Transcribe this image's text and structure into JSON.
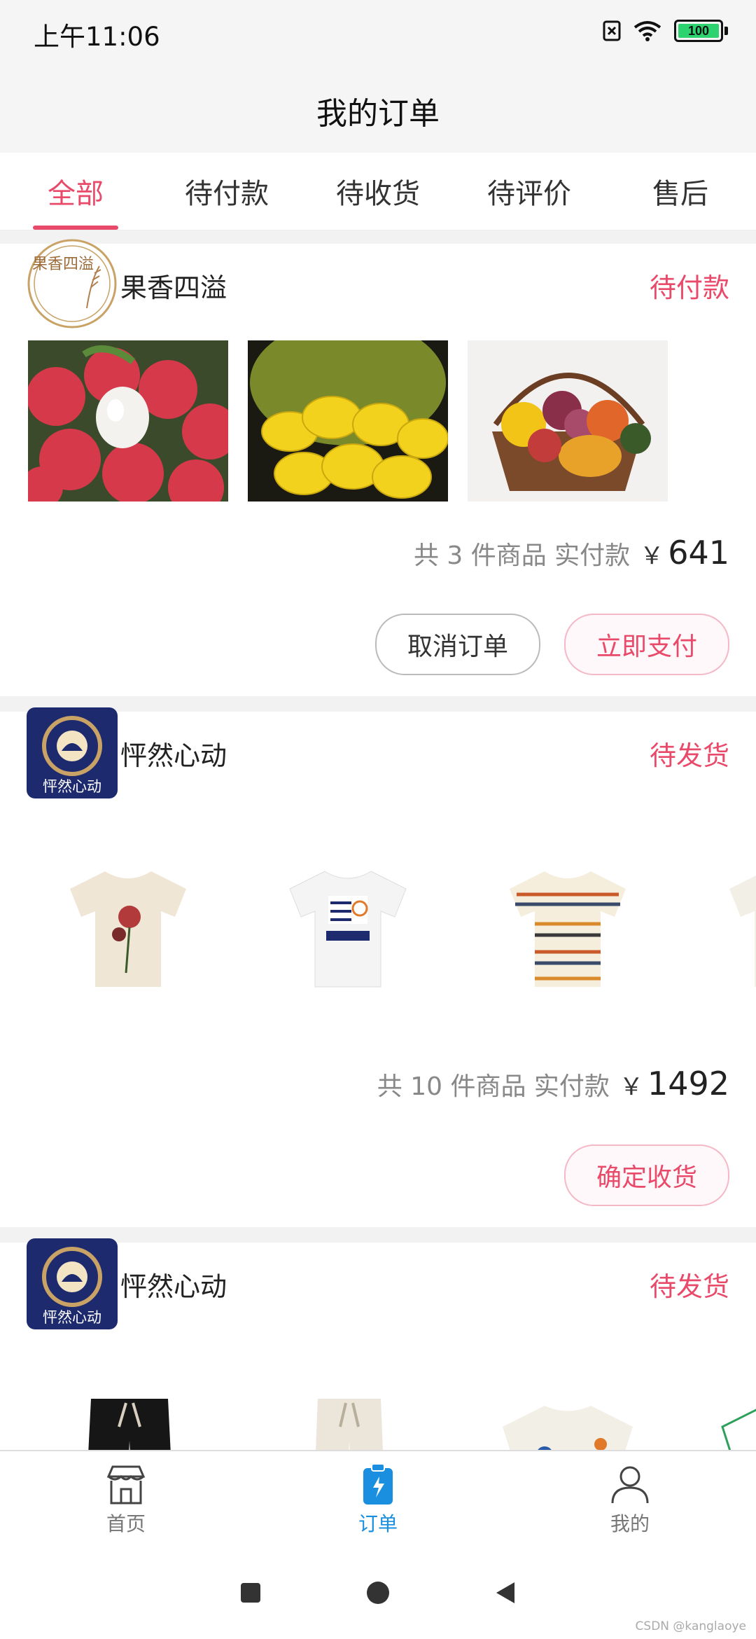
{
  "status_bar": {
    "time": "上午11:06",
    "battery": "100"
  },
  "header": {
    "title": "我的订单"
  },
  "tabs": [
    {
      "label": "全部",
      "active": true
    },
    {
      "label": "待付款",
      "active": false
    },
    {
      "label": "待收货",
      "active": false
    },
    {
      "label": "待评价",
      "active": false
    },
    {
      "label": "售后",
      "active": false
    }
  ],
  "orders": [
    {
      "shop": "果香四溢",
      "logo_text": "果香四溢",
      "status": "待付款",
      "summary_prefix": "共 3 件商品 实付款",
      "currency": "￥",
      "amount": "641",
      "buttons": [
        "取消订单",
        "立即支付"
      ],
      "goods": [
        "lychee",
        "jackfruit",
        "fruit-basket"
      ]
    },
    {
      "shop": "怦然心动",
      "logo_text": "怦然心动",
      "status": "待发货",
      "summary_prefix": "共 10 件商品 实付款",
      "currency": "￥",
      "amount": "1492",
      "buttons": [
        "确定收货"
      ],
      "goods": [
        "floral-tshirt",
        "graphic-tshirt",
        "striped-tshirt",
        "print-shirt"
      ]
    },
    {
      "shop": "怦然心动",
      "logo_text": "怦然心动",
      "status": "待发货",
      "goods": [
        "black-pants",
        "beige-pants",
        "print-shirt",
        "green-shirt"
      ]
    }
  ],
  "bottom_nav": [
    {
      "label": "首页",
      "icon": "shop-icon",
      "active": false
    },
    {
      "label": "订单",
      "icon": "clipboard-icon",
      "active": true
    },
    {
      "label": "我的",
      "icon": "person-icon",
      "active": false
    }
  ],
  "watermark": "CSDN @kanglaoye",
  "colors": {
    "accent": "#e94a6a",
    "tab_active": "#1a8fe0",
    "logo_navy": "#1e2a6e",
    "logo_gold": "#c9a266"
  }
}
